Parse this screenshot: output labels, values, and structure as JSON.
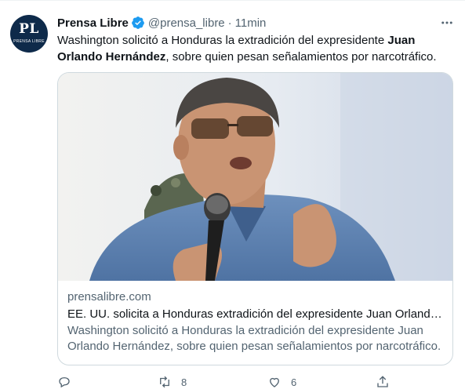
{
  "tweet": {
    "author_name": "Prensa Libre",
    "handle": "@prensa_libre",
    "separator": "·",
    "time": "11min",
    "text_before": "Washington solicitó a Honduras la extradición del expresidente ",
    "text_bold": "Juan Orlando Hernández",
    "text_after": ", sobre quien pesan señalamientos por narcotráfico.",
    "avatar": {
      "initials": "PL",
      "subtext": "PRENSA LIBRE"
    }
  },
  "card": {
    "domain": "prensalibre.com",
    "title": "EE. UU. solicita a Honduras extradición del expresidente Juan Orlando Hernández",
    "description": "Washington solicitó a Honduras la extradición del expresidente Juan Orlando Hernández, sobre quien pesan señalamientos por narcotráfico."
  },
  "actions": {
    "reply_count": "",
    "retweet_count": "8",
    "like_count": "6"
  },
  "colors": {
    "verified": "#1d9bf0",
    "secondary_text": "#536471",
    "border": "#cfd9de"
  }
}
